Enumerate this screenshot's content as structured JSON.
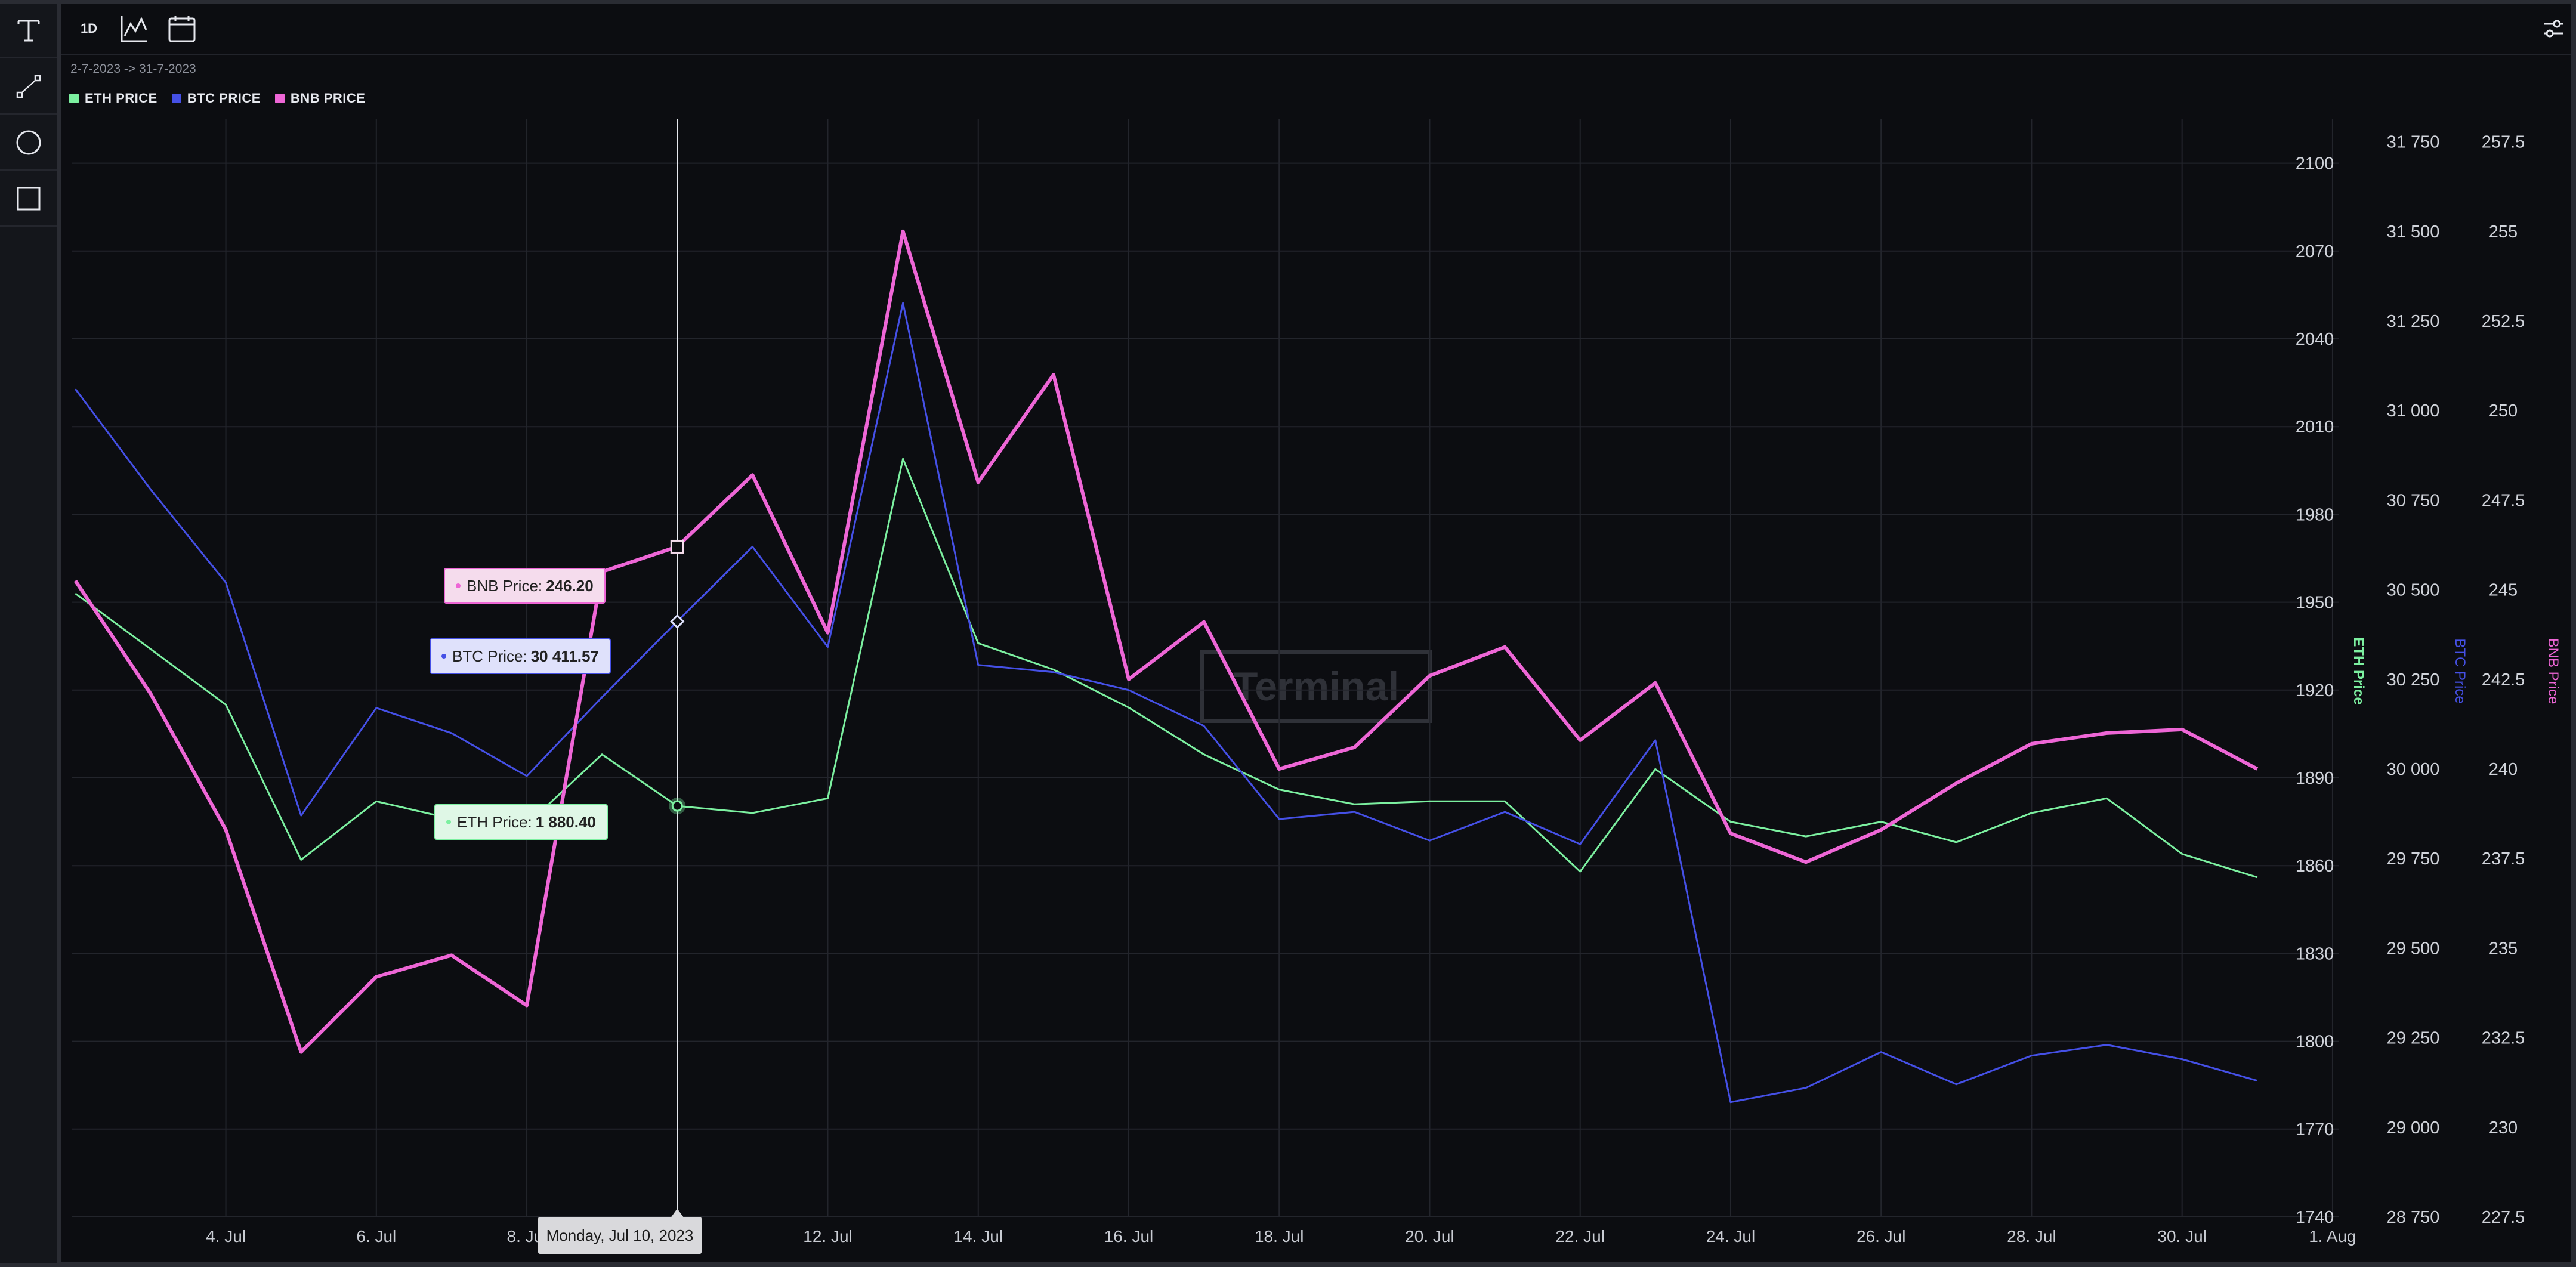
{
  "toolbar": {
    "tools": [
      {
        "name": "text-tool",
        "icon": "text-icon"
      },
      {
        "name": "line-tool",
        "icon": "line-icon"
      },
      {
        "name": "circle-tool",
        "icon": "circle-icon"
      },
      {
        "name": "rectangle-tool",
        "icon": "rectangle-icon"
      }
    ]
  },
  "topbar": {
    "interval_label": "1D",
    "chart_type_icon": "line-chart-icon",
    "calendar_icon": "calendar-icon",
    "settings_icon": "sliders-icon"
  },
  "range_label": "2-7-2023 -> 31-7-2023",
  "watermark": "Terminal",
  "crosshair": {
    "date_label": "Monday, Jul 10, 2023",
    "eth": {
      "label": "ETH Price:",
      "value": "1 880.40"
    },
    "btc": {
      "label": "BTC Price:",
      "value": "30 411.57"
    },
    "bnb": {
      "label": "BNB Price:",
      "value": "246.20"
    }
  },
  "chart_data": {
    "type": "line",
    "x": [
      "2023-07-02",
      "2023-07-03",
      "2023-07-04",
      "2023-07-05",
      "2023-07-06",
      "2023-07-07",
      "2023-07-08",
      "2023-07-09",
      "2023-07-10",
      "2023-07-11",
      "2023-07-12",
      "2023-07-13",
      "2023-07-14",
      "2023-07-15",
      "2023-07-16",
      "2023-07-17",
      "2023-07-18",
      "2023-07-19",
      "2023-07-20",
      "2023-07-21",
      "2023-07-22",
      "2023-07-23",
      "2023-07-24",
      "2023-07-25",
      "2023-07-26",
      "2023-07-27",
      "2023-07-28",
      "2023-07-29",
      "2023-07-30",
      "2023-07-31"
    ],
    "x_ticks": [
      "4. Jul",
      "6. Jul",
      "8. Jul",
      "10. Jul",
      "12. Jul",
      "14. Jul",
      "16. Jul",
      "18. Jul",
      "20. Jul",
      "22. Jul",
      "24. Jul",
      "26. Jul",
      "28. Jul",
      "30. Jul",
      "1. Aug"
    ],
    "series": [
      {
        "name": "ETH PRICE",
        "axis_title": "ETH Price",
        "color": "#7cf0a0",
        "values": [
          1953,
          1934,
          1915,
          1862,
          1882,
          1876,
          1874,
          1898,
          1880.4,
          1878,
          1883,
          1999,
          1936,
          1927,
          1914,
          1898,
          1886,
          1881,
          1882,
          1882,
          1858,
          1893,
          1875,
          1870,
          1875,
          1868,
          1878,
          1883,
          1864,
          1856
        ]
      },
      {
        "name": "BTC PRICE",
        "axis_title": "BTC Price",
        "color": "#4550e6",
        "values": [
          31060,
          30780,
          30520,
          29870,
          30170,
          30100,
          29980,
          30200,
          30411.57,
          30620,
          30340,
          31300,
          30290,
          30270,
          30220,
          30120,
          29860,
          29880,
          29800,
          29880,
          29790,
          30080,
          29070,
          29110,
          29210,
          29120,
          29200,
          29230,
          29190,
          29130
        ]
      },
      {
        "name": "BNB PRICE",
        "axis_title": "BNB Price",
        "color": "#ee66d6",
        "values": [
          245.25,
          242.1,
          238.3,
          232.1,
          234.2,
          234.8,
          233.4,
          245.5,
          246.2,
          248.2,
          243.8,
          255.0,
          248.0,
          251.0,
          242.5,
          244.1,
          240.0,
          240.6,
          242.6,
          243.4,
          240.8,
          242.4,
          238.2,
          237.4,
          238.3,
          239.6,
          240.7,
          241.0,
          241.1,
          240.0
        ]
      }
    ],
    "axes": [
      {
        "series": "ETH PRICE",
        "ylim": [
          1740,
          2115
        ],
        "ticks": [
          "1740",
          "1770",
          "1800",
          "1830",
          "1860",
          "1890",
          "1920",
          "1950",
          "1980",
          "2010",
          "2040",
          "2070",
          "2100"
        ],
        "tick_values": [
          1740,
          1770,
          1800,
          1830,
          1860,
          1890,
          1920,
          1950,
          1980,
          2010,
          2040,
          2070,
          2100
        ]
      },
      {
        "series": "BTC PRICE",
        "ylim": [
          28750,
          31812.5
        ],
        "ticks": [
          "28 750",
          "29 000",
          "29 250",
          "29 500",
          "29 750",
          "30 000",
          "30 250",
          "30 500",
          "30 750",
          "31 000",
          "31 250",
          "31 500",
          "31 750"
        ],
        "tick_values": [
          28750,
          29000,
          29250,
          29500,
          29750,
          30000,
          30250,
          30500,
          30750,
          31000,
          31250,
          31500,
          31750
        ]
      },
      {
        "series": "BNB PRICE",
        "ylim": [
          227.5,
          258.125
        ],
        "ticks": [
          "227.5",
          "230",
          "232.5",
          "235",
          "237.5",
          "240",
          "242.5",
          "245",
          "247.5",
          "250",
          "252.5",
          "255",
          "257.5"
        ],
        "tick_values": [
          227.5,
          230,
          232.5,
          235,
          237.5,
          240,
          242.5,
          245,
          247.5,
          250,
          252.5,
          255,
          257.5
        ]
      }
    ],
    "grid": true,
    "legend_position": "top-left",
    "crosshair_x": "2023-07-10"
  }
}
